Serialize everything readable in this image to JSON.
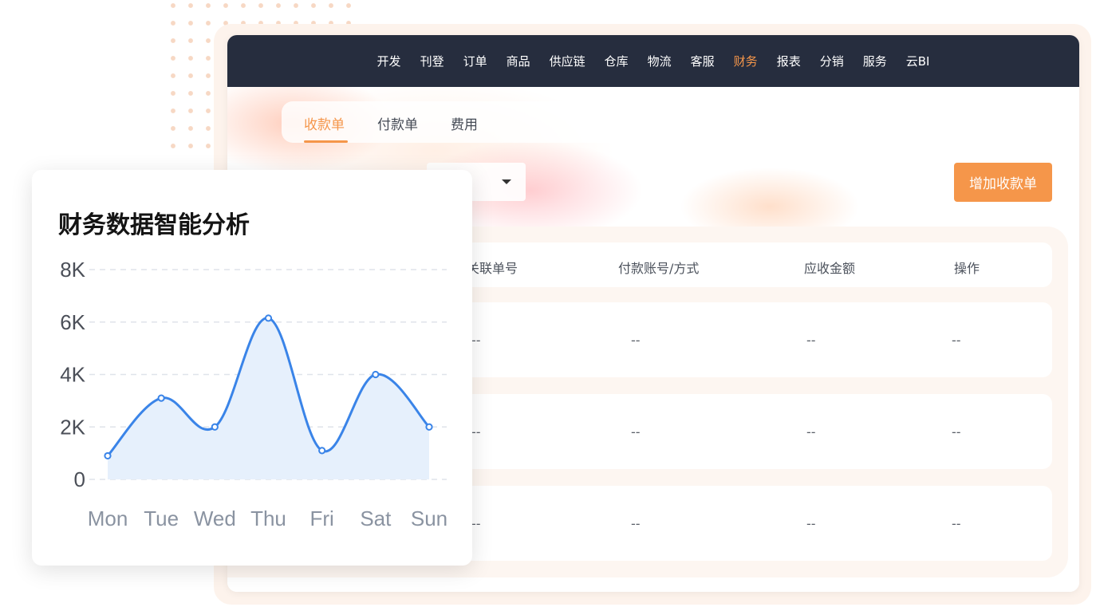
{
  "nav": {
    "items": [
      "开发",
      "刊登",
      "订单",
      "商品",
      "供应链",
      "仓库",
      "物流",
      "客服",
      "财务",
      "报表",
      "分销",
      "服务",
      "云BI"
    ],
    "active": "财务"
  },
  "tabs": {
    "items": [
      "收款单",
      "付款单",
      "费用"
    ],
    "active": "收款单"
  },
  "toolbar": {
    "add_label": "增加收款单"
  },
  "table": {
    "headers": [
      "关联单号",
      "付款账号/方式",
      "应收金额",
      "操作"
    ],
    "rows": [
      [
        "--",
        "--",
        "--",
        "--"
      ],
      [
        "--",
        "--",
        "--",
        "--"
      ],
      [
        "--",
        "--",
        "--",
        "--"
      ]
    ]
  },
  "colors": {
    "accent": "#f5964a",
    "nav_bg": "#262d3e",
    "line": "#3a84e8",
    "area": "#e6f0fc"
  },
  "chart_card": {
    "title": "财务数据智能分析"
  },
  "chart_data": {
    "type": "area",
    "title": "财务数据智能分析",
    "categories": [
      "Mon",
      "Tue",
      "Wed",
      "Thu",
      "Fri",
      "Sat",
      "Sun"
    ],
    "values": [
      900,
      3100,
      2000,
      6150,
      1100,
      4000,
      2000
    ],
    "yticks": [
      "0",
      "2K",
      "4K",
      "6K",
      "8K"
    ],
    "ylim": [
      0,
      8000
    ],
    "smooth": true,
    "grid": true
  }
}
